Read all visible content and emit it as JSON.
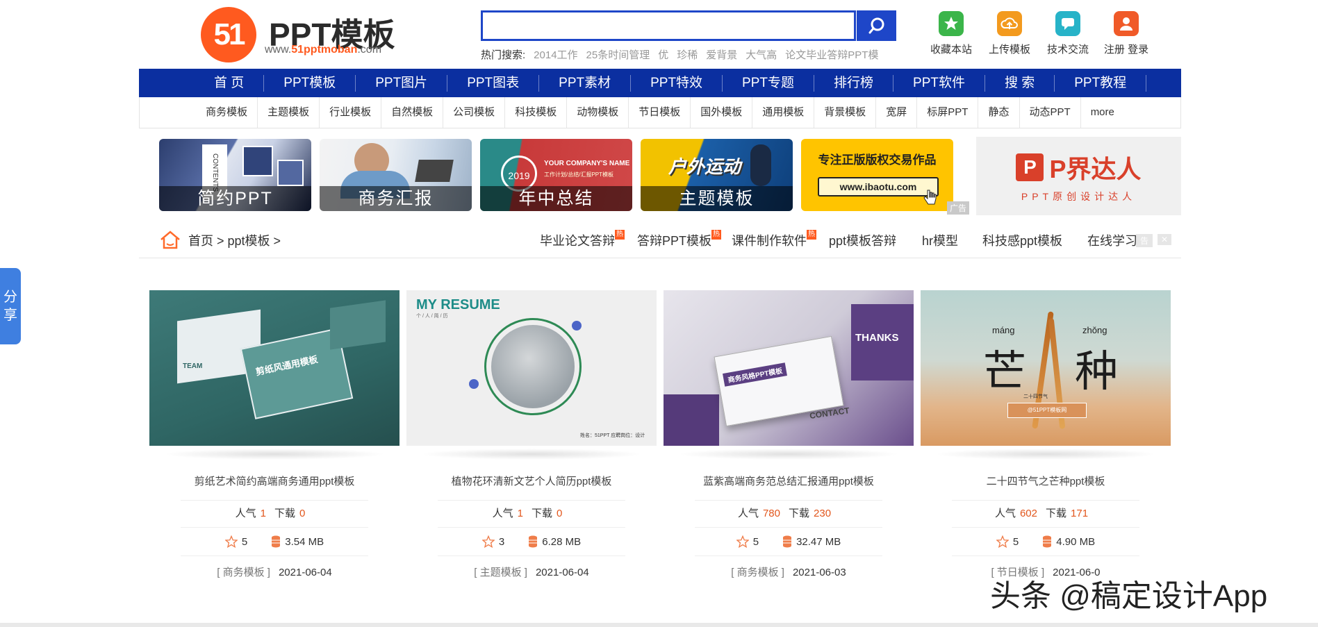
{
  "logo": {
    "badge": "51",
    "title": "PPT模板",
    "url_prefix": "www.",
    "url_brand": "51pptmoban",
    "url_suffix": ".com"
  },
  "search": {
    "value": "",
    "placeholder": "",
    "hot_label": "热门搜索:",
    "hot_keywords": [
      "2014工作",
      "25条时间管理",
      "优",
      "珍稀",
      "爱背景",
      "大气高",
      "论文毕业答辩PPT模"
    ]
  },
  "top_tools": [
    {
      "label": "收藏本站",
      "icon": "star-icon",
      "color": "#3bb54a"
    },
    {
      "label": "上传模板",
      "icon": "upload-cloud-icon",
      "color": "#f39a1e"
    },
    {
      "label": "技术交流",
      "icon": "chat-icon",
      "color": "#27b3c8"
    },
    {
      "label": "注册 登录",
      "icon": "user-icon",
      "color": "#f05a28"
    }
  ],
  "nav": [
    "首 页",
    "PPT模板",
    "PPT图片",
    "PPT图表",
    "PPT素材",
    "PPT特效",
    "PPT专题",
    "排行榜",
    "PPT软件",
    "搜 索",
    "PPT教程"
  ],
  "subnav": [
    "商务模板",
    "主题模板",
    "行业模板",
    "自然模板",
    "公司模板",
    "科技模板",
    "动物模板",
    "节日模板",
    "国外模板",
    "通用模板",
    "背景模板",
    "宽屏",
    "标屏PPT",
    "静态",
    "动态PPT",
    "more"
  ],
  "banners": [
    {
      "caption": "简约PPT",
      "side_text": "CONTENTS"
    },
    {
      "caption": "商务汇报"
    },
    {
      "caption": "年中总结",
      "year": "2019",
      "headline": "YOUR COMPANY'S NAME",
      "sub": "工作计划/总结/汇报PPT模板"
    },
    {
      "caption": "主题模板",
      "headline": "户外运动"
    },
    {
      "headline": "专注正版版权交易作品",
      "url": "www.ibaotu.com"
    }
  ],
  "ad": {
    "tag": "广告",
    "brand": "P界达人",
    "slogan": "PPT原创设计达人"
  },
  "breadcrumb": {
    "home": "首页",
    "sep1": " > ",
    "section": "ppt模板",
    "sep2": " >"
  },
  "quicklinks": [
    {
      "label": "毕业论文答辩",
      "hot": "热"
    },
    {
      "label": "答辩PPT模板",
      "hot": "热"
    },
    {
      "label": "课件制作软件",
      "hot": "热"
    },
    {
      "label": "ppt模板答辩",
      "hot": ""
    },
    {
      "label": "hr模型",
      "hot": ""
    },
    {
      "label": "科技感ppt模板",
      "hot": ""
    },
    {
      "label": "在线学习",
      "hot": ""
    }
  ],
  "ad_small": {
    "tag": "告",
    "close": "✕"
  },
  "share": {
    "line1": "分",
    "line2": "享"
  },
  "cards": [
    {
      "title": "剪纸艺术简约高端商务通用ppt模板",
      "pop_label": "人气",
      "pop": "1",
      "dl_label": "下载",
      "dl": "0",
      "stars": "5",
      "size": "3.54 MB",
      "category": "[ 商务模板 ]",
      "date": "2021-06-04",
      "thumb": {
        "card_text": "剪纸风通用模板",
        "team": "TEAM"
      }
    },
    {
      "title": "植物花环清新文艺个人简历ppt模板",
      "pop_label": "人气",
      "pop": "1",
      "dl_label": "下载",
      "dl": "0",
      "stars": "3",
      "size": "6.28 MB",
      "category": "[ 主题模板 ]",
      "date": "2021-06-04",
      "thumb": {
        "heading": "MY RESUME",
        "sub": "个 / 人 / 简 / 历",
        "footer": "姓名：51PPT    应聘岗位：设计"
      }
    },
    {
      "title": "蓝紫高端商务范总结汇报通用ppt模板",
      "pop_label": "人气",
      "pop": "780",
      "dl_label": "下载",
      "dl": "230",
      "stars": "5",
      "size": "32.47 MB",
      "category": "[ 商务模板 ]",
      "date": "2021-06-03",
      "thumb": {
        "box_title": "商务风格PPT模板",
        "thanks": "THANKS",
        "contact": "CONTACT"
      }
    },
    {
      "title": "二十四节气之芒种ppt模板",
      "pop_label": "人气",
      "pop": "602",
      "dl_label": "下载",
      "dl": "171",
      "stars": "5",
      "size": "4.90 MB",
      "category": "[ 节日模板 ]",
      "date": "2021-06-0",
      "thumb": {
        "pinyin1": "máng",
        "pinyin2": "zhǒng",
        "char1": "芒",
        "char2": "种",
        "small": "二十四节气",
        "badge": "@51PPT模板网"
      }
    }
  ],
  "watermark": "头条 @稿定设计App"
}
